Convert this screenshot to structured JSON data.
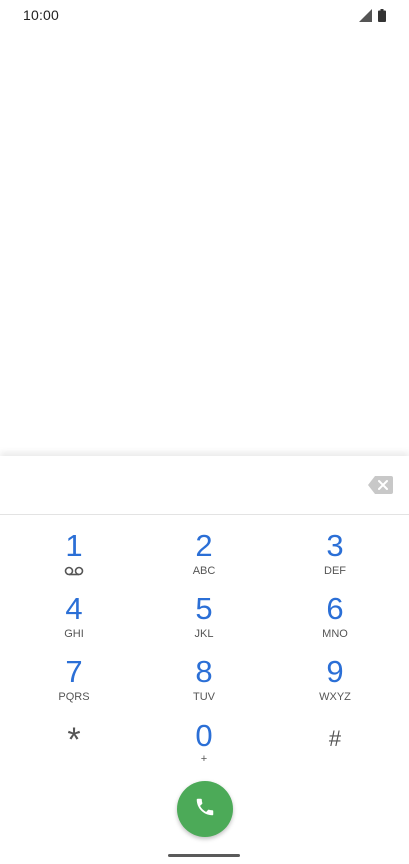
{
  "status_bar": {
    "time": "10:00",
    "icons": [
      "signal-icon",
      "battery-icon"
    ]
  },
  "dialer": {
    "number_value": "",
    "keys": [
      {
        "digit": "1",
        "letters": "",
        "sub_icon": "voicemail-icon"
      },
      {
        "digit": "2",
        "letters": "ABC"
      },
      {
        "digit": "3",
        "letters": "DEF"
      },
      {
        "digit": "4",
        "letters": "GHI"
      },
      {
        "digit": "5",
        "letters": "JKL"
      },
      {
        "digit": "6",
        "letters": "MNO"
      },
      {
        "digit": "7",
        "letters": "PQRS"
      },
      {
        "digit": "8",
        "letters": "TUV"
      },
      {
        "digit": "9",
        "letters": "WXYZ"
      },
      {
        "digit": "*",
        "letters": ""
      },
      {
        "digit": "0",
        "letters": "+"
      },
      {
        "digit": "#",
        "letters": ""
      }
    ],
    "call_icon": "phone-icon",
    "backspace_icon": "backspace-icon"
  },
  "colors": {
    "digit_blue": "#2b6fd6",
    "call_green": "#4caa58"
  }
}
